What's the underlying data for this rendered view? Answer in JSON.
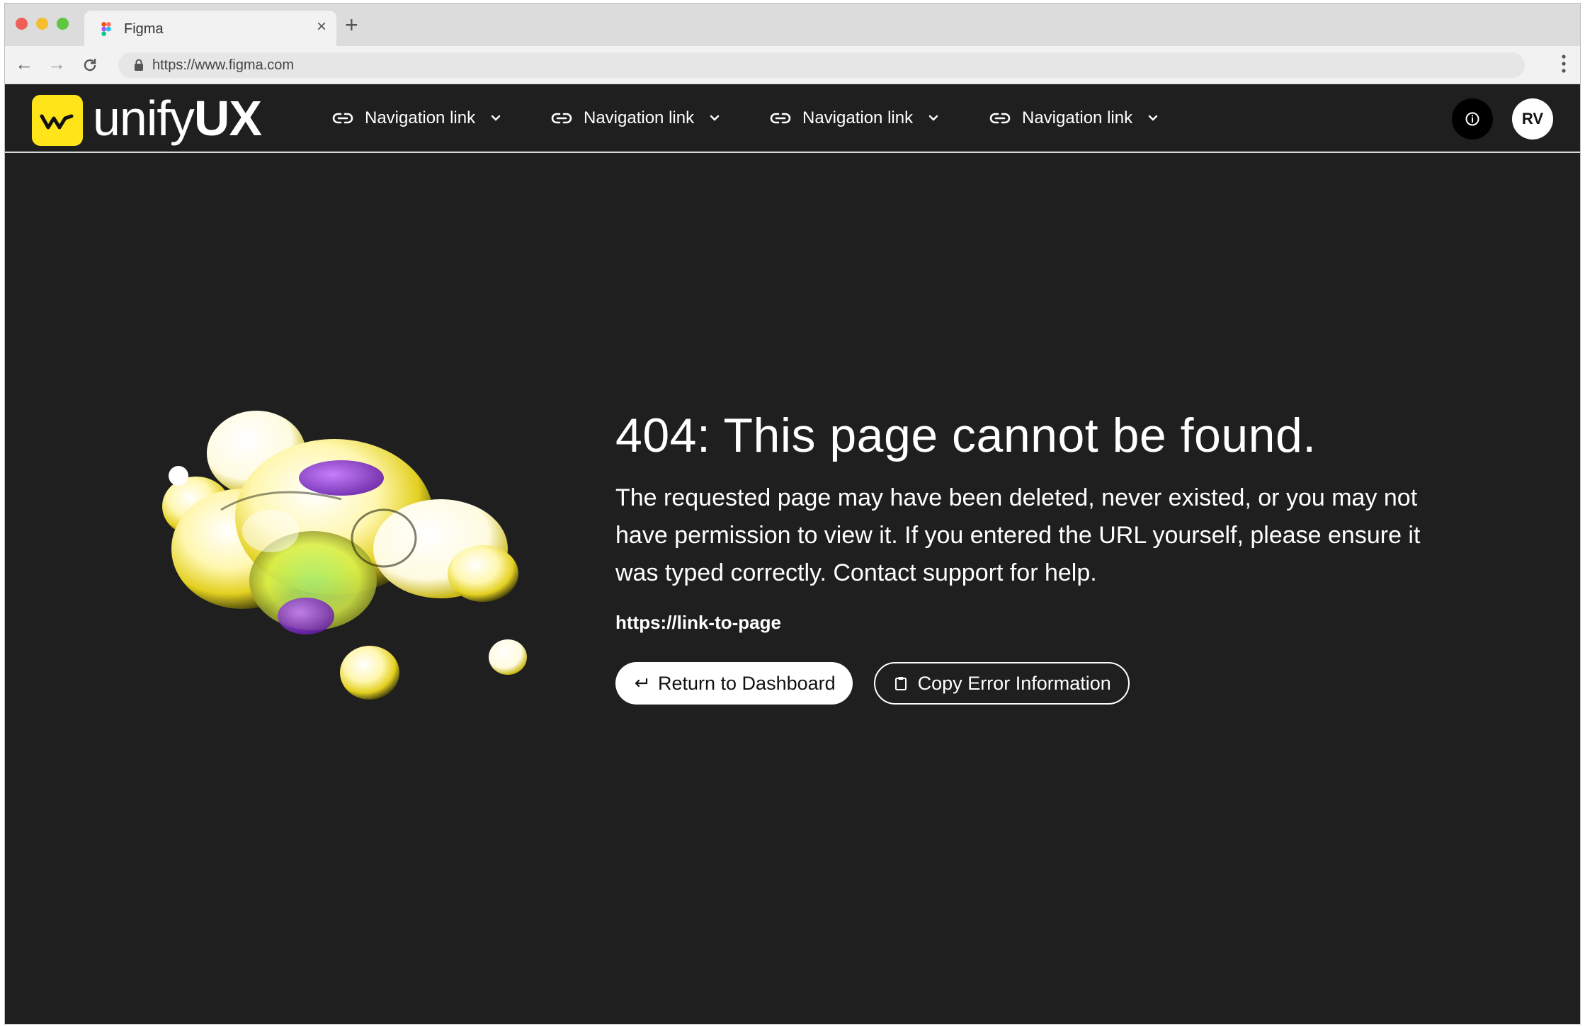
{
  "browser": {
    "tab_title": "Figma",
    "url_display": "https://www.figma.com",
    "new_tab_label": "+",
    "close_tab_label": "×"
  },
  "header": {
    "logo_light": "unify",
    "logo_bold": "UX",
    "nav_links": [
      {
        "label": "Navigation link"
      },
      {
        "label": "Navigation link"
      },
      {
        "label": "Navigation link"
      },
      {
        "label": "Navigation link"
      }
    ],
    "avatar_initials": "RV"
  },
  "error": {
    "title": "404: This page cannot be found.",
    "description": "The requested page may have been deleted, never existed, or you may not have permission to view it. If you entered the URL yourself, please ensure it was typed correctly. Contact support for help.",
    "link": "https://link-to-page",
    "primary_button": "Return to Dashboard",
    "secondary_button": "Copy Error Information"
  },
  "colors": {
    "background": "#1f1f1f",
    "logo_accent": "#ffe419",
    "text": "#ffffff"
  },
  "icons": {
    "nav": "link-icon",
    "dropdown": "chevron-down-icon",
    "info": "info-icon",
    "return": "return-arrow-icon",
    "copy": "clipboard-icon"
  }
}
